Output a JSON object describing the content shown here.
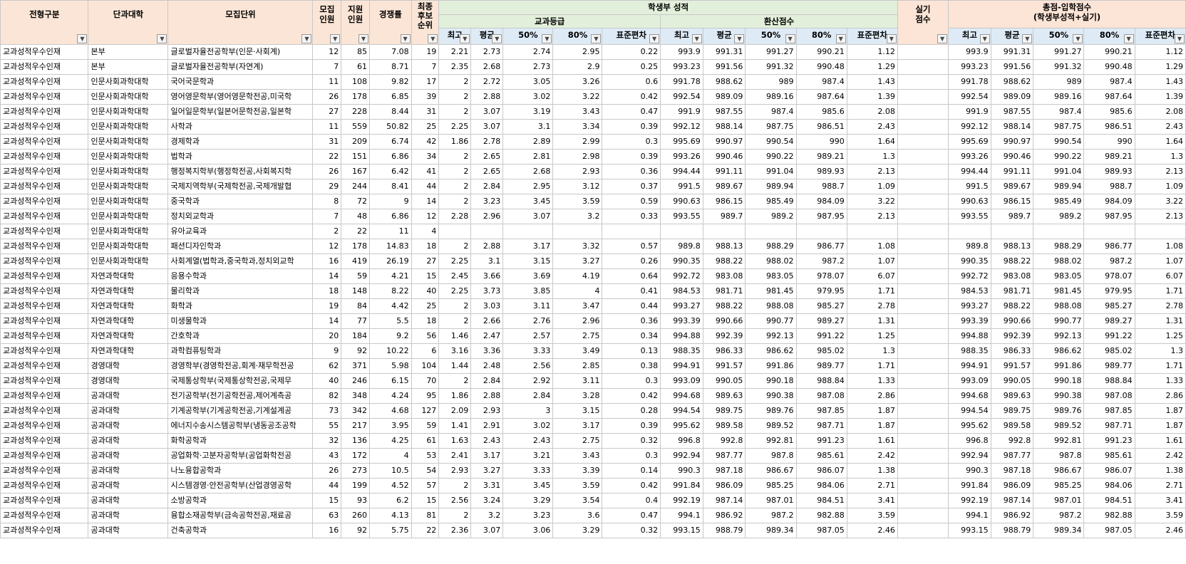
{
  "headers": {
    "admission_type": "전형구분",
    "college": "단과대학",
    "unit": "모집단위",
    "quota": "모집\n인원",
    "applicants": "지원\n인원",
    "ratio": "경쟁률",
    "final_waitlist": "최종\n후보\n순위",
    "student_record": "학생부 성적",
    "subject_grade": "교과등급",
    "converted_score": "환산점수",
    "practical": "실기\n점수",
    "total": "총점-입학점수\n(학생부성적+실기)",
    "stats": [
      "최고",
      "평균",
      "50%",
      "80%",
      "표준편차"
    ]
  },
  "colors": {
    "header_pink": "#fbe5d6",
    "header_green": "#e2efda",
    "header_blue": "#deebf7",
    "grid": "#c8c8c8"
  },
  "icons": {
    "filter": "dropdown-filter-icon"
  },
  "rows": [
    [
      "교과성적우수인재",
      "본부",
      "글로벌자율전공학부(인문·사회계)",
      "12",
      "85",
      "7.08",
      "19",
      "2.21",
      "2.73",
      "2.74",
      "2.95",
      "0.22",
      "993.9",
      "991.31",
      "991.27",
      "990.21",
      "1.12",
      "",
      "993.9",
      "991.31",
      "991.27",
      "990.21",
      "1.12"
    ],
    [
      "교과성적우수인재",
      "본부",
      "글로벌자율전공학부(자연계)",
      "7",
      "61",
      "8.71",
      "7",
      "2.35",
      "2.68",
      "2.73",
      "2.9",
      "0.25",
      "993.23",
      "991.56",
      "991.32",
      "990.48",
      "1.29",
      "",
      "993.23",
      "991.56",
      "991.32",
      "990.48",
      "1.29"
    ],
    [
      "교과성적우수인재",
      "인문사회과학대학",
      "국어국문학과",
      "11",
      "108",
      "9.82",
      "17",
      "2",
      "2.72",
      "3.05",
      "3.26",
      "0.6",
      "991.78",
      "988.62",
      "989",
      "987.4",
      "1.43",
      "",
      "991.78",
      "988.62",
      "989",
      "987.4",
      "1.43"
    ],
    [
      "교과성적우수인재",
      "인문사회과학대학",
      "영어영문학부(영어영문학전공,미국학",
      "26",
      "178",
      "6.85",
      "39",
      "2",
      "2.88",
      "3.02",
      "3.22",
      "0.42",
      "992.54",
      "989.09",
      "989.16",
      "987.64",
      "1.39",
      "",
      "992.54",
      "989.09",
      "989.16",
      "987.64",
      "1.39"
    ],
    [
      "교과성적우수인재",
      "인문사회과학대학",
      "일어일문학부(일본어문학전공,일본학",
      "27",
      "228",
      "8.44",
      "31",
      "2",
      "3.07",
      "3.19",
      "3.43",
      "0.47",
      "991.9",
      "987.55",
      "987.4",
      "985.6",
      "2.08",
      "",
      "991.9",
      "987.55",
      "987.4",
      "985.6",
      "2.08"
    ],
    [
      "교과성적우수인재",
      "인문사회과학대학",
      "사학과",
      "11",
      "559",
      "50.82",
      "25",
      "2.25",
      "3.07",
      "3.1",
      "3.34",
      "0.39",
      "992.12",
      "988.14",
      "987.75",
      "986.51",
      "2.43",
      "",
      "992.12",
      "988.14",
      "987.75",
      "986.51",
      "2.43"
    ],
    [
      "교과성적우수인재",
      "인문사회과학대학",
      "경제학과",
      "31",
      "209",
      "6.74",
      "42",
      "1.86",
      "2.78",
      "2.89",
      "2.99",
      "0.3",
      "995.69",
      "990.97",
      "990.54",
      "990",
      "1.64",
      "",
      "995.69",
      "990.97",
      "990.54",
      "990",
      "1.64"
    ],
    [
      "교과성적우수인재",
      "인문사회과학대학",
      "법학과",
      "22",
      "151",
      "6.86",
      "34",
      "2",
      "2.65",
      "2.81",
      "2.98",
      "0.39",
      "993.26",
      "990.46",
      "990.22",
      "989.21",
      "1.3",
      "",
      "993.26",
      "990.46",
      "990.22",
      "989.21",
      "1.3"
    ],
    [
      "교과성적우수인재",
      "인문사회과학대학",
      "행정복지학부(행정학전공,사회복지학",
      "26",
      "167",
      "6.42",
      "41",
      "2",
      "2.65",
      "2.68",
      "2.93",
      "0.36",
      "994.44",
      "991.11",
      "991.04",
      "989.93",
      "2.13",
      "",
      "994.44",
      "991.11",
      "991.04",
      "989.93",
      "2.13"
    ],
    [
      "교과성적우수인재",
      "인문사회과학대학",
      "국제지역학부(국제학전공,국제개발협",
      "29",
      "244",
      "8.41",
      "44",
      "2",
      "2.84",
      "2.95",
      "3.12",
      "0.37",
      "991.5",
      "989.67",
      "989.94",
      "988.7",
      "1.09",
      "",
      "991.5",
      "989.67",
      "989.94",
      "988.7",
      "1.09"
    ],
    [
      "교과성적우수인재",
      "인문사회과학대학",
      "중국학과",
      "8",
      "72",
      "9",
      "14",
      "2",
      "3.23",
      "3.45",
      "3.59",
      "0.59",
      "990.63",
      "986.15",
      "985.49",
      "984.09",
      "3.22",
      "",
      "990.63",
      "986.15",
      "985.49",
      "984.09",
      "3.22"
    ],
    [
      "교과성적우수인재",
      "인문사회과학대학",
      "정치외교학과",
      "7",
      "48",
      "6.86",
      "12",
      "2.28",
      "2.96",
      "3.07",
      "3.2",
      "0.33",
      "993.55",
      "989.7",
      "989.2",
      "987.95",
      "2.13",
      "",
      "993.55",
      "989.7",
      "989.2",
      "987.95",
      "2.13"
    ],
    [
      "교과성적우수인재",
      "인문사회과학대학",
      "유아교육과",
      "2",
      "22",
      "11",
      "4",
      "",
      "",
      "",
      "",
      "",
      "",
      "",
      "",
      "",
      "",
      "",
      "",
      "",
      "",
      "",
      ""
    ],
    [
      "교과성적우수인재",
      "인문사회과학대학",
      "패션디자인학과",
      "12",
      "178",
      "14.83",
      "18",
      "2",
      "2.88",
      "3.17",
      "3.32",
      "0.57",
      "989.8",
      "988.13",
      "988.29",
      "986.77",
      "1.08",
      "",
      "989.8",
      "988.13",
      "988.29",
      "986.77",
      "1.08"
    ],
    [
      "교과성적우수인재",
      "인문사회과학대학",
      "사회계열(법학과,중국학과,정치외교학",
      "16",
      "419",
      "26.19",
      "27",
      "2.25",
      "3.1",
      "3.15",
      "3.27",
      "0.26",
      "990.35",
      "988.22",
      "988.02",
      "987.2",
      "1.07",
      "",
      "990.35",
      "988.22",
      "988.02",
      "987.2",
      "1.07"
    ],
    [
      "교과성적우수인재",
      "자연과학대학",
      "응용수학과",
      "14",
      "59",
      "4.21",
      "15",
      "2.45",
      "3.66",
      "3.69",
      "4.19",
      "0.64",
      "992.72",
      "983.08",
      "983.05",
      "978.07",
      "6.07",
      "",
      "992.72",
      "983.08",
      "983.05",
      "978.07",
      "6.07"
    ],
    [
      "교과성적우수인재",
      "자연과학대학",
      "물리학과",
      "18",
      "148",
      "8.22",
      "40",
      "2.25",
      "3.73",
      "3.85",
      "4",
      "0.41",
      "984.53",
      "981.71",
      "981.45",
      "979.95",
      "1.71",
      "",
      "984.53",
      "981.71",
      "981.45",
      "979.95",
      "1.71"
    ],
    [
      "교과성적우수인재",
      "자연과학대학",
      "화학과",
      "19",
      "84",
      "4.42",
      "25",
      "2",
      "3.03",
      "3.11",
      "3.47",
      "0.44",
      "993.27",
      "988.22",
      "988.08",
      "985.27",
      "2.78",
      "",
      "993.27",
      "988.22",
      "988.08",
      "985.27",
      "2.78"
    ],
    [
      "교과성적우수인재",
      "자연과학대학",
      "미생물학과",
      "14",
      "77",
      "5.5",
      "18",
      "2",
      "2.66",
      "2.76",
      "2.96",
      "0.36",
      "993.39",
      "990.66",
      "990.77",
      "989.27",
      "1.31",
      "",
      "993.39",
      "990.66",
      "990.77",
      "989.27",
      "1.31"
    ],
    [
      "교과성적우수인재",
      "자연과학대학",
      "간호학과",
      "20",
      "184",
      "9.2",
      "56",
      "1.46",
      "2.47",
      "2.57",
      "2.75",
      "0.34",
      "994.88",
      "992.39",
      "992.13",
      "991.22",
      "1.25",
      "",
      "994.88",
      "992.39",
      "992.13",
      "991.22",
      "1.25"
    ],
    [
      "교과성적우수인재",
      "자연과학대학",
      "과학컴퓨팅학과",
      "9",
      "92",
      "10.22",
      "6",
      "3.16",
      "3.36",
      "3.33",
      "3.49",
      "0.13",
      "988.35",
      "986.33",
      "986.62",
      "985.02",
      "1.3",
      "",
      "988.35",
      "986.33",
      "986.62",
      "985.02",
      "1.3"
    ],
    [
      "교과성적우수인재",
      "경영대학",
      "경영학부(경영학전공,회계·재무학전공",
      "62",
      "371",
      "5.98",
      "104",
      "1.44",
      "2.48",
      "2.56",
      "2.85",
      "0.38",
      "994.91",
      "991.57",
      "991.86",
      "989.77",
      "1.71",
      "",
      "994.91",
      "991.57",
      "991.86",
      "989.77",
      "1.71"
    ],
    [
      "교과성적우수인재",
      "경영대학",
      "국제통상학부(국제통상학전공,국제무",
      "40",
      "246",
      "6.15",
      "70",
      "2",
      "2.84",
      "2.92",
      "3.11",
      "0.3",
      "993.09",
      "990.05",
      "990.18",
      "988.84",
      "1.33",
      "",
      "993.09",
      "990.05",
      "990.18",
      "988.84",
      "1.33"
    ],
    [
      "교과성적우수인재",
      "공과대학",
      "전기공학부(전기공학전공,제어계측공",
      "82",
      "348",
      "4.24",
      "95",
      "1.86",
      "2.88",
      "2.84",
      "3.28",
      "0.42",
      "994.68",
      "989.63",
      "990.38",
      "987.08",
      "2.86",
      "",
      "994.68",
      "989.63",
      "990.38",
      "987.08",
      "2.86"
    ],
    [
      "교과성적우수인재",
      "공과대학",
      "기계공학부(기계공학전공,기계설계공",
      "73",
      "342",
      "4.68",
      "127",
      "2.09",
      "2.93",
      "3",
      "3.15",
      "0.28",
      "994.54",
      "989.75",
      "989.76",
      "987.85",
      "1.87",
      "",
      "994.54",
      "989.75",
      "989.76",
      "987.85",
      "1.87"
    ],
    [
      "교과성적우수인재",
      "공과대학",
      "에너지수송시스템공학부(냉동공조공학",
      "55",
      "217",
      "3.95",
      "59",
      "1.41",
      "2.91",
      "3.02",
      "3.17",
      "0.39",
      "995.62",
      "989.58",
      "989.52",
      "987.71",
      "1.87",
      "",
      "995.62",
      "989.58",
      "989.52",
      "987.71",
      "1.87"
    ],
    [
      "교과성적우수인재",
      "공과대학",
      "화학공학과",
      "32",
      "136",
      "4.25",
      "61",
      "1.63",
      "2.43",
      "2.43",
      "2.75",
      "0.32",
      "996.8",
      "992.8",
      "992.81",
      "991.23",
      "1.61",
      "",
      "996.8",
      "992.8",
      "992.81",
      "991.23",
      "1.61"
    ],
    [
      "교과성적우수인재",
      "공과대학",
      "공업화학·고분자공학부(공업화학전공",
      "43",
      "172",
      "4",
      "53",
      "2.41",
      "3.17",
      "3.21",
      "3.43",
      "0.3",
      "992.94",
      "987.77",
      "987.8",
      "985.61",
      "2.42",
      "",
      "992.94",
      "987.77",
      "987.8",
      "985.61",
      "2.42"
    ],
    [
      "교과성적우수인재",
      "공과대학",
      "나노융합공학과",
      "26",
      "273",
      "10.5",
      "54",
      "2.93",
      "3.27",
      "3.33",
      "3.39",
      "0.14",
      "990.3",
      "987.18",
      "986.67",
      "986.07",
      "1.38",
      "",
      "990.3",
      "987.18",
      "986.67",
      "986.07",
      "1.38"
    ],
    [
      "교과성적우수인재",
      "공과대학",
      "시스템경영·안전공학부(산업경영공학",
      "44",
      "199",
      "4.52",
      "57",
      "2",
      "3.31",
      "3.45",
      "3.59",
      "0.42",
      "991.84",
      "986.09",
      "985.25",
      "984.06",
      "2.71",
      "",
      "991.84",
      "986.09",
      "985.25",
      "984.06",
      "2.71"
    ],
    [
      "교과성적우수인재",
      "공과대학",
      "소방공학과",
      "15",
      "93",
      "6.2",
      "15",
      "2.56",
      "3.24",
      "3.29",
      "3.54",
      "0.4",
      "992.19",
      "987.14",
      "987.01",
      "984.51",
      "3.41",
      "",
      "992.19",
      "987.14",
      "987.01",
      "984.51",
      "3.41"
    ],
    [
      "교과성적우수인재",
      "공과대학",
      "융합소재공학부(금속공학전공,재료공",
      "63",
      "260",
      "4.13",
      "81",
      "2",
      "3.2",
      "3.23",
      "3.6",
      "0.47",
      "994.1",
      "986.92",
      "987.2",
      "982.88",
      "3.59",
      "",
      "994.1",
      "986.92",
      "987.2",
      "982.88",
      "3.59"
    ],
    [
      "교과성적우수인재",
      "공과대학",
      "건축공학과",
      "16",
      "92",
      "5.75",
      "22",
      "2.36",
      "3.07",
      "3.06",
      "3.29",
      "0.32",
      "993.15",
      "988.79",
      "989.34",
      "987.05",
      "2.46",
      "",
      "993.15",
      "988.79",
      "989.34",
      "987.05",
      "2.46"
    ]
  ]
}
